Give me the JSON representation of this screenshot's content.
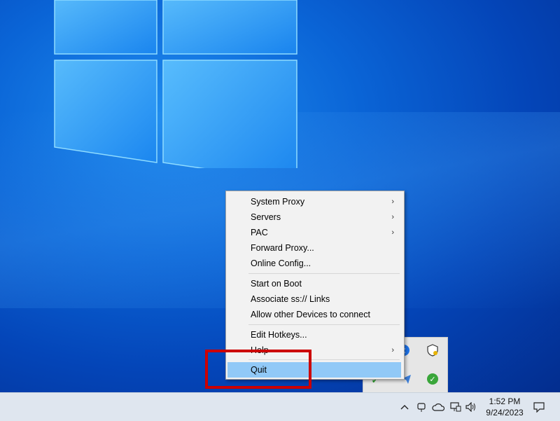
{
  "menu": {
    "items": [
      {
        "label": "System Proxy",
        "submenu": true
      },
      {
        "label": "Servers",
        "submenu": true
      },
      {
        "label": "PAC",
        "submenu": true
      },
      {
        "label": "Forward Proxy...",
        "submenu": false
      },
      {
        "label": "Online Config...",
        "submenu": false
      },
      {
        "label": "Start on Boot",
        "submenu": false
      },
      {
        "label": "Associate ss:// Links",
        "submenu": false
      },
      {
        "label": "Allow other Devices to connect",
        "submenu": false
      },
      {
        "label": "Edit Hotkeys...",
        "submenu": false
      },
      {
        "label": "Help",
        "submenu": true
      },
      {
        "label": "Quit",
        "submenu": false,
        "highlighted": true
      }
    ],
    "submenu_arrow": "›"
  },
  "taskbar": {
    "time": "1:52 PM",
    "date": "9/24/2023",
    "icons": [
      "chevron-up-icon",
      "meet-now-icon",
      "onedrive-cloud-icon",
      "network-icon",
      "volume-icon",
      "notification-icon"
    ]
  },
  "tray_popup": {
    "icons": [
      "bluetooth-icon",
      "windows-security-icon",
      "shadowsocks-icon",
      "send-icon",
      "green-check-icon"
    ]
  },
  "colors": {
    "highlight": "#91c9f7",
    "annotation": "#cc0000"
  }
}
